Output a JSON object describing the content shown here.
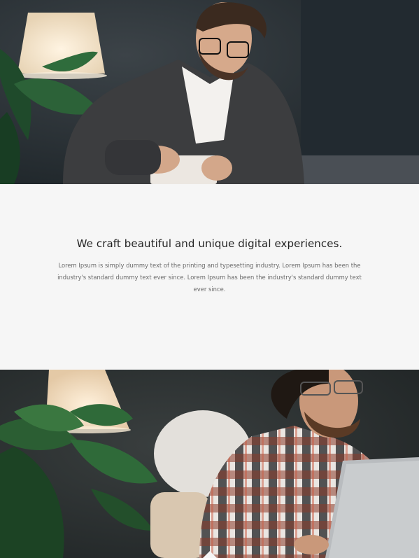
{
  "intro": {
    "heading": "We craft beautiful and unique digital experiences.",
    "body": "Lorem Ipsum is simply dummy text of the printing and typesetting industry. Lorem Ipsum has been the industry's standard dummy text ever since. Lorem Ipsum has been the industry's standard dummy text ever since."
  },
  "images": {
    "top": "man-opening-box-photo",
    "bottom": "man-plaid-shirt-laptop-photo"
  },
  "colors": {
    "band_background": "#f6f6f6",
    "heading": "#222222",
    "body_text": "#6a6a6a"
  }
}
